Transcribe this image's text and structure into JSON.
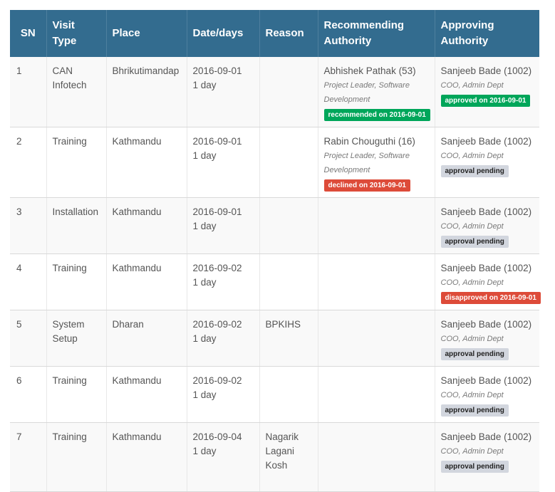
{
  "headers": {
    "sn": "SN",
    "visit_type": "Visit Type",
    "place": "Place",
    "date_days": "Date/days",
    "reason": "Reason",
    "recommending": "Recommending Authority",
    "approving": "Approving Authority"
  },
  "rows": [
    {
      "sn": "1",
      "visit_type": "CAN Infotech",
      "place": "Bhrikutimandap",
      "date": "2016-09-01",
      "days": "1 day",
      "reason": "",
      "rec_name": "Abhishek Pathak (53)",
      "rec_role": "Project Leader, Software Development",
      "rec_status": "recommended on 2016-09-01",
      "rec_status_type": "recommended",
      "app_name": "Sanjeeb Bade (1002)",
      "app_role": "COO, Admin Dept",
      "app_status": "approved on 2016-09-01",
      "app_status_type": "approved"
    },
    {
      "sn": "2",
      "visit_type": "Training",
      "place": "Kathmandu",
      "date": "2016-09-01",
      "days": "1 day",
      "reason": "",
      "rec_name": "Rabin Chouguthi (16)",
      "rec_role": "Project Leader, Software Development",
      "rec_status": "declined on 2016-09-01",
      "rec_status_type": "declined",
      "app_name": "Sanjeeb Bade (1002)",
      "app_role": "COO, Admin Dept",
      "app_status": "approval pending",
      "app_status_type": "pending"
    },
    {
      "sn": "3",
      "visit_type": "Installation",
      "place": "Kathmandu",
      "date": "2016-09-01",
      "days": "1 day",
      "reason": "",
      "rec_name": "",
      "rec_role": "",
      "rec_status": "",
      "rec_status_type": "",
      "app_name": "Sanjeeb Bade (1002)",
      "app_role": "COO, Admin Dept",
      "app_status": "approval pending",
      "app_status_type": "pending"
    },
    {
      "sn": "4",
      "visit_type": "Training",
      "place": "Kathmandu",
      "date": "2016-09-02",
      "days": "1 day",
      "reason": "",
      "rec_name": "",
      "rec_role": "",
      "rec_status": "",
      "rec_status_type": "",
      "app_name": "Sanjeeb Bade (1002)",
      "app_role": "COO, Admin Dept",
      "app_status": "disapproved on 2016-09-01",
      "app_status_type": "disapproved"
    },
    {
      "sn": "5",
      "visit_type": "System Setup",
      "place": "Dharan",
      "date": "2016-09-02",
      "days": "1 day",
      "reason": "BPKIHS",
      "rec_name": "",
      "rec_role": "",
      "rec_status": "",
      "rec_status_type": "",
      "app_name": "Sanjeeb Bade (1002)",
      "app_role": "COO, Admin Dept",
      "app_status": "approval pending",
      "app_status_type": "pending"
    },
    {
      "sn": "6",
      "visit_type": "Training",
      "place": "Kathmandu",
      "date": "2016-09-02",
      "days": "1 day",
      "reason": "",
      "rec_name": "",
      "rec_role": "",
      "rec_status": "",
      "rec_status_type": "",
      "app_name": "Sanjeeb Bade (1002)",
      "app_role": "COO, Admin Dept",
      "app_status": "approval pending",
      "app_status_type": "pending"
    },
    {
      "sn": "7",
      "visit_type": "Training",
      "place": "Kathmandu",
      "date": "2016-09-04",
      "days": "1 day",
      "reason": "Nagarik Lagani Kosh",
      "rec_name": "",
      "rec_role": "",
      "rec_status": "",
      "rec_status_type": "",
      "app_name": "Sanjeeb Bade (1002)",
      "app_role": "COO, Admin Dept",
      "app_status": "approval pending",
      "app_status_type": "pending"
    }
  ]
}
